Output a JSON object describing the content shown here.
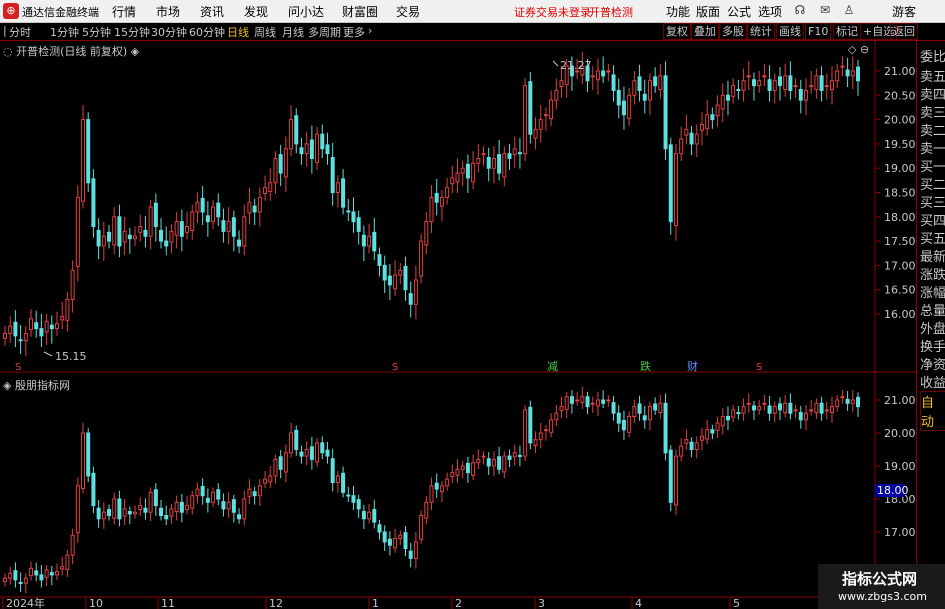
{
  "menubar": {
    "app_title": "通达信金融终端",
    "items": [
      "行情",
      "市场",
      "资讯",
      "发现",
      "问小达",
      "财富圈",
      "交易"
    ],
    "warnings": [
      "证券交易未登录",
      "开普检测"
    ],
    "right_items": [
      "功能",
      "版面",
      "公式",
      "选项"
    ],
    "guest": "游客"
  },
  "toolbar": {
    "periods": [
      "分时",
      "1分钟",
      "5分钟",
      "15分钟",
      "30分钟",
      "60分钟",
      "日线",
      "周线",
      "月线",
      "多周期",
      "更多"
    ],
    "active": "日线",
    "right_buttons": [
      "复权",
      "叠加",
      "多股",
      "统计",
      "画线",
      "F10",
      "标记",
      "+自选",
      "返回"
    ]
  },
  "sidebar": {
    "items": [
      "委比",
      "卖五",
      "卖四",
      "卖三",
      "卖二",
      "卖一",
      "买一",
      "买二",
      "买三",
      "买四",
      "买五",
      "最新",
      "涨跌",
      "涨幅",
      "总量",
      "外盘",
      "换手",
      "净资",
      "收益"
    ],
    "auto": "自动"
  },
  "main_panel": {
    "title": "开普检测(日线 前复权)",
    "high_label": "21.27",
    "low_label": "15.15",
    "event_labels": [
      "S",
      "S",
      "减",
      "跌",
      "财",
      "S"
    ]
  },
  "sub_panel": {
    "title": "殷朋指标网",
    "price_tag": "18.00"
  },
  "x_axis_labels": [
    "2024年",
    "10",
    "11",
    "12",
    "1",
    "2",
    "3",
    "4",
    "5"
  ],
  "watermark": {
    "line1": "指标公式网",
    "line2": "www.zbgs3.com"
  },
  "colors": {
    "up": "#e04040",
    "down": "#5ce0e0",
    "frame": "#8b0000",
    "active": "#e8c020"
  },
  "chart_data": {
    "type": "candlestick",
    "y_ticks_main": [
      16.0,
      16.5,
      17.0,
      17.5,
      18.0,
      18.5,
      19.0,
      19.5,
      20.0,
      20.5,
      21.0
    ],
    "y_ticks_sub": [
      17.0,
      18.0,
      19.0,
      20.0,
      21.0
    ],
    "close": [
      15.6,
      15.75,
      15.55,
      15.45,
      15.6,
      15.9,
      15.7,
      15.55,
      15.85,
      15.7,
      15.8,
      15.95,
      16.3,
      16.9,
      18.4,
      20.0,
      18.7,
      17.8,
      17.4,
      17.6,
      17.5,
      18.0,
      17.4,
      17.7,
      17.55,
      17.6,
      17.8,
      17.6,
      18.2,
      17.8,
      17.5,
      17.4,
      17.7,
      17.9,
      17.6,
      17.8,
      18.1,
      18.3,
      18.1,
      17.9,
      18.2,
      18.0,
      17.7,
      17.9,
      17.6,
      17.4,
      18.0,
      18.3,
      18.1,
      18.4,
      18.6,
      18.7,
      19.2,
      18.9,
      19.4,
      20.0,
      19.5,
      19.3,
      19.5,
      19.2,
      19.7,
      19.4,
      19.3,
      18.5,
      18.7,
      18.2,
      18.1,
      17.9,
      17.7,
      17.4,
      17.6,
      17.3,
      17.0,
      16.7,
      16.6,
      16.8,
      16.9,
      16.5,
      16.2,
      16.7,
      17.5,
      17.9,
      18.4,
      18.3,
      18.4,
      18.6,
      18.8,
      18.9,
      19.0,
      18.8,
      19.1,
      19.2,
      19.3,
      19.0,
      19.2,
      18.9,
      19.3,
      19.2,
      19.4,
      19.3,
      20.7,
      19.7,
      19.8,
      20.0,
      20.1,
      20.4,
      20.6,
      20.8,
      21.1,
      20.9,
      21.0,
      21.1,
      20.8,
      20.9,
      21.0,
      20.9,
      21.0,
      20.6,
      20.3,
      20.1,
      20.5,
      20.8,
      20.6,
      20.4,
      20.8,
      20.7,
      20.9,
      19.4,
      17.9,
      19.3,
      19.6,
      19.8,
      19.5,
      19.7,
      19.9,
      20.1,
      20.0,
      20.3,
      20.5,
      20.4,
      20.7,
      20.6,
      20.8,
      20.9,
      20.7,
      20.8,
      20.9,
      20.6,
      20.8,
      20.7,
      20.9,
      20.6,
      20.7,
      20.4,
      20.6,
      20.7,
      20.9,
      20.6,
      20.7,
      20.8,
      21.0,
      21.1,
      20.9,
      21.0,
      20.8
    ]
  }
}
